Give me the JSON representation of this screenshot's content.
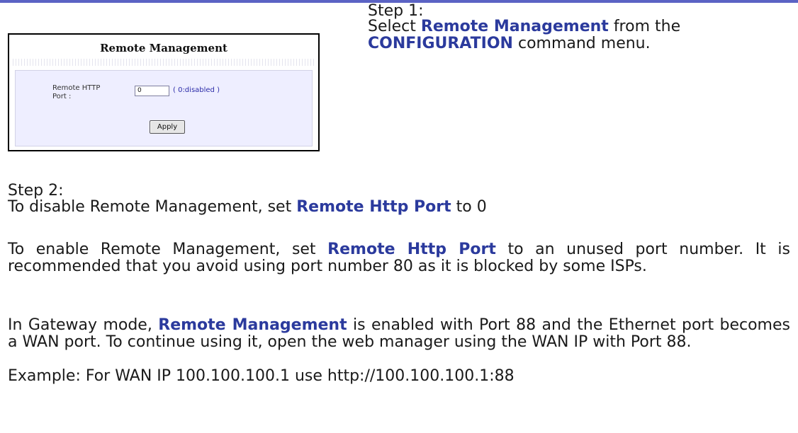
{
  "screenshot": {
    "title": "Remote Management",
    "field_label": "Remote HTTP Port :",
    "port_value": "0",
    "port_hint": "( 0:disabled )",
    "apply_label": "Apply"
  },
  "step1": {
    "heading": "Step 1:",
    "pre": "Select",
    "link1": "Remote Management",
    "mid": "from the",
    "link2": "CONFIGURATION",
    "post": "command menu."
  },
  "step2": {
    "heading": "Step 2:",
    "p1_pre": "To disable Remote Management, set",
    "p1_link": "Remote Http Port",
    "p1_post": "to 0",
    "p2_pre": "To enable Remote Management, set",
    "p2_link": "Remote Http Port",
    "p2_post": "to an unused port number. It is recommended that you avoid using port number 80 as it is blocked by some ISPs.",
    "p3_pre": "In Gateway mode,",
    "p3_link": "Remote Management",
    "p3_post": "is enabled with Port 88 and the Ethernet port becomes a WAN port. To continue using it, open the web manager using the WAN IP with Port 88.",
    "example": "Example: For WAN IP 100.100.100.1 use http://100.100.100.1:88"
  },
  "colors": {
    "accent": "#2b3a9d",
    "rule": "#5b63c4",
    "panel_bg": "#eeeeff"
  }
}
